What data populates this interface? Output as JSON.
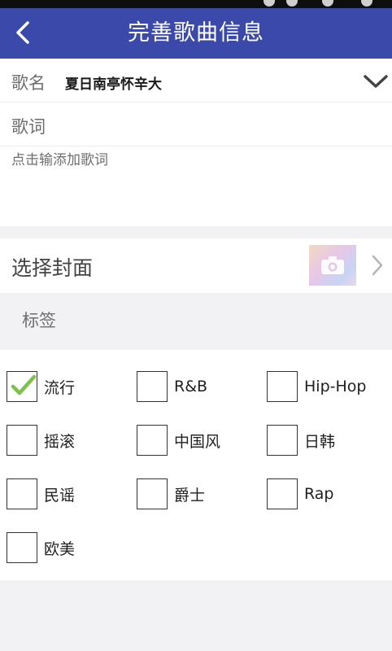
{
  "appbar": {
    "title": "完善歌曲信息"
  },
  "song": {
    "name_label": "歌名",
    "name_value": "夏日南亭怀辛大",
    "lyrics_label": "歌词",
    "lyrics_placeholder": "点击输添加歌词"
  },
  "cover": {
    "label": "选择封面"
  },
  "tags": {
    "title": "标签",
    "items": [
      {
        "label": "流行",
        "checked": true
      },
      {
        "label": "R&B",
        "checked": false
      },
      {
        "label": "Hip-Hop",
        "checked": false
      },
      {
        "label": "摇滚",
        "checked": false
      },
      {
        "label": "中国风",
        "checked": false
      },
      {
        "label": "日韩",
        "checked": false
      },
      {
        "label": "民谣",
        "checked": false
      },
      {
        "label": "爵士",
        "checked": false
      },
      {
        "label": "Rap",
        "checked": false
      },
      {
        "label": "欧美",
        "checked": false
      }
    ]
  },
  "colors": {
    "appbar": "#3b49ab",
    "check": "#7cc24a"
  }
}
